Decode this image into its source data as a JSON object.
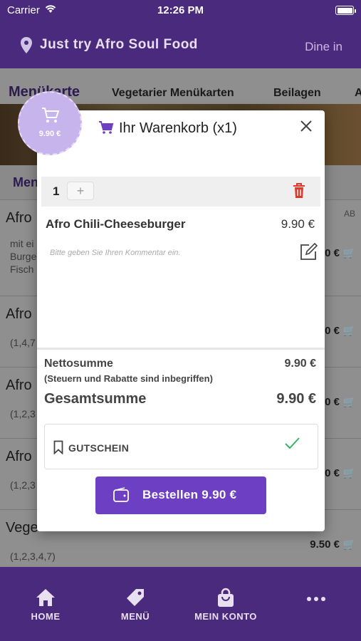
{
  "status": {
    "carrier": "Carrier",
    "time": "12:26 PM"
  },
  "header": {
    "restaurant": "Just try Afro Soul Food",
    "mode": "Dine in"
  },
  "background": {
    "tabs": [
      "Menükarte",
      "Vegetarier Menükarten",
      "Beilagen",
      "A"
    ],
    "sub": "Men",
    "rows": [
      {
        "name": "Afro",
        "desc": [
          "mit ei",
          "Burge",
          "Fisch"
        ],
        "price": "0 €",
        "ab": "AB"
      },
      {
        "name": "Afro",
        "desc": [
          "(1,4,7"
        ],
        "price": "0 €"
      },
      {
        "name": "Afro",
        "desc": [
          "(1,2,3"
        ],
        "price": "0 €"
      },
      {
        "name": "Afro",
        "desc": [
          "(1,2,3"
        ],
        "price": "0 €"
      },
      {
        "name": "Vege",
        "desc": [
          "(1,2,3,4,7)"
        ],
        "price": "9.50 €"
      }
    ]
  },
  "badge": {
    "amount": "9.90 €"
  },
  "modal": {
    "title": "Ihr Warenkorb (x1)",
    "quantity": "1",
    "plus": "+",
    "item_name": "Afro Chili-Cheeseburger",
    "item_price": "9.90 €",
    "comment_placeholder": "Bitte geben Sie Ihren Kommentar ein.",
    "netto_label": "Nettosumme",
    "netto_sub": "(Steuern und Rabatte sind inbegriffen)",
    "netto_value": "9.90 €",
    "total_label": "Gesamtsumme",
    "total_value": "9.90 €",
    "coupon_label": "GUTSCHEIN",
    "order_label": "Bestellen 9.90 €"
  },
  "nav": {
    "home": "HOME",
    "menu": "MENÜ",
    "account": "MEIN KONTO"
  },
  "colors": {
    "primary": "#4a2a7c",
    "accent": "#6d3fc2",
    "delete": "#e0382a",
    "check": "#3bb36a"
  }
}
